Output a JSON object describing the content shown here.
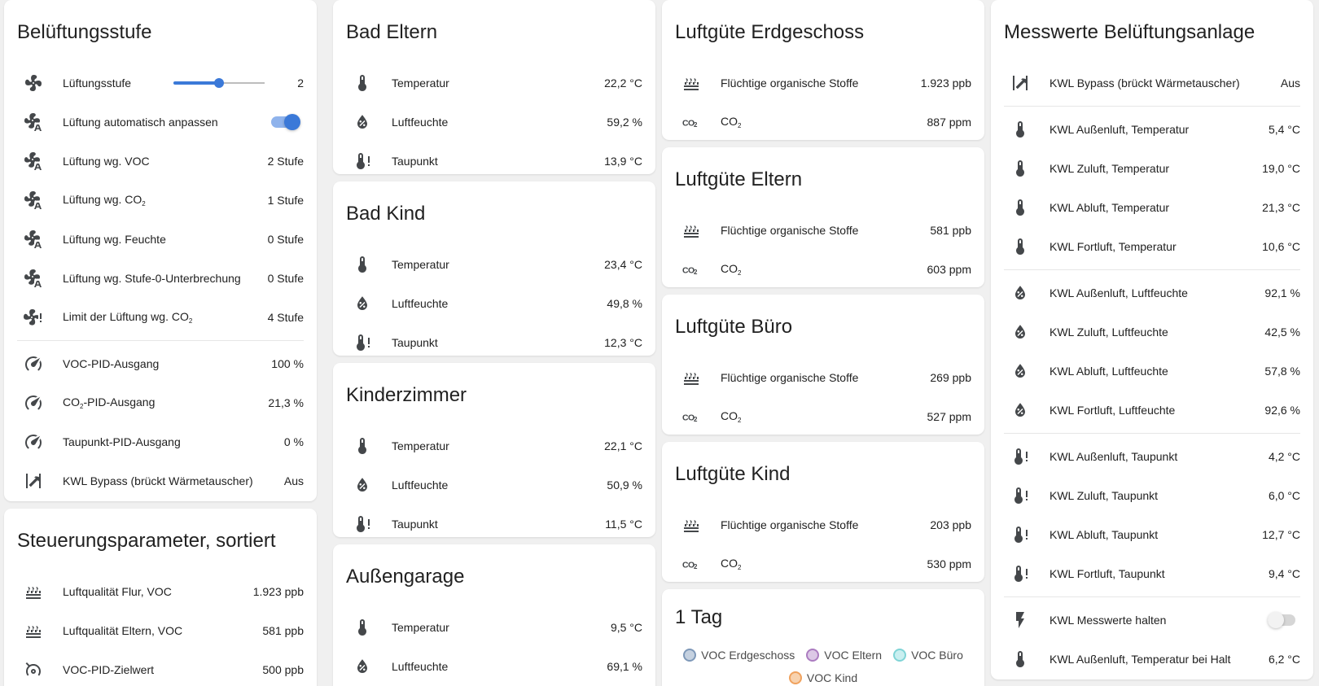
{
  "colors": {
    "accent": "#3b79d8",
    "background": "#f0f0f0",
    "card": "#ffffff",
    "icon": "#44474a"
  },
  "col1": {
    "card1": {
      "title": "Belüftungsstufe",
      "fan_speed": {
        "label": "Lüftungsstufe",
        "value": "2",
        "slider_fraction": 0.5
      },
      "auto_adjust": {
        "label": "Lüftung automatisch anpassen",
        "state": "on"
      },
      "voc": {
        "label": "Lüftung wg. VOC",
        "value": "2 Stufe"
      },
      "co2": {
        "label": "Lüftung wg. CO",
        "sub": "2",
        "value": "1 Stufe"
      },
      "humidity": {
        "label": "Lüftung wg. Feuchte",
        "value": "0 Stufe"
      },
      "stage0": {
        "label": "Lüftung wg. Stufe-0-Unterbrechung",
        "value": "0 Stufe"
      },
      "limit_co2": {
        "label": "Limit der Lüftung wg. CO",
        "sub": "2",
        "value": "4 Stufe"
      },
      "voc_pid": {
        "label": "VOC-PID-Ausgang",
        "value": "100 %"
      },
      "co2_pid": {
        "label_pre": "CO",
        "sub": "2",
        "label_post": "-PID-Ausgang",
        "value": "21,3 %"
      },
      "dew_pid": {
        "label": "Taupunkt-PID-Ausgang",
        "value": "0 %"
      },
      "bypass": {
        "label": "KWL Bypass (brückt Wärmetauscher)",
        "value": "Aus"
      }
    },
    "card2": {
      "title": "Steuerungsparameter, sortiert",
      "rows": [
        {
          "label": "Luftqualität Flur, VOC",
          "value": "1.923 ppb",
          "icon": "voc-icon"
        },
        {
          "label": "Luftqualität Eltern, VOC",
          "value": "581 ppb",
          "icon": "voc-icon"
        },
        {
          "label": "VOC-PID-Zielwert",
          "value": "500 ppb",
          "icon": "target-gauge-icon"
        }
      ]
    }
  },
  "col2": {
    "bad_eltern": {
      "title": "Bad Eltern",
      "temp_label": "Temperatur",
      "temp": "22,2 °C",
      "hum_label": "Luftfeuchte",
      "hum": "59,2 %",
      "dew_label": "Taupunkt",
      "dew": "13,9 °C"
    },
    "bad_kind": {
      "title": "Bad Kind",
      "temp_label": "Temperatur",
      "temp": "23,4 °C",
      "hum_label": "Luftfeuchte",
      "hum": "49,8 %",
      "dew_label": "Taupunkt",
      "dew": "12,3 °C"
    },
    "kinderzimmer": {
      "title": "Kinderzimmer",
      "temp_label": "Temperatur",
      "temp": "22,1 °C",
      "hum_label": "Luftfeuchte",
      "hum": "50,9 %",
      "dew_label": "Taupunkt",
      "dew": "11,5 °C"
    },
    "aussengarage": {
      "title": "Außengarage",
      "temp_label": "Temperatur",
      "temp": "9,5 °C",
      "hum_label": "Luftfeuchte",
      "hum": "69,1 %"
    }
  },
  "col3": {
    "erdgeschoss": {
      "title": "Luftgüte Erdgeschoss",
      "voc_label": "Flüchtige organische Stoffe",
      "voc": "1.923 ppb",
      "co2_label": "CO",
      "co2_sub": "2",
      "co2": "887 ppm"
    },
    "eltern": {
      "title": "Luftgüte Eltern",
      "voc_label": "Flüchtige organische Stoffe",
      "voc": "581 ppb",
      "co2_label": "CO",
      "co2_sub": "2",
      "co2": "603 ppm"
    },
    "buero": {
      "title": "Luftgüte Büro",
      "voc_label": "Flüchtige organische Stoffe",
      "voc": "269 ppb",
      "co2_label": "CO",
      "co2_sub": "2",
      "co2": "527 ppm"
    },
    "kind": {
      "title": "Luftgüte Kind",
      "voc_label": "Flüchtige organische Stoffe",
      "voc": "203 ppb",
      "co2_label": "CO",
      "co2_sub": "2",
      "co2": "530 ppm"
    },
    "history": {
      "title": "1 Tag",
      "legend": [
        {
          "name": "VOC Erdgeschoss",
          "color": "#7e98b8",
          "fill": "#c5d1e0"
        },
        {
          "name": "VOC Eltern",
          "color": "#ab7cc0",
          "fill": "#dcc8e6"
        },
        {
          "name": "VOC Büro",
          "color": "#7fd4d6",
          "fill": "#c9eff0"
        },
        {
          "name": "VOC Kind",
          "color": "#f0a25e",
          "fill": "#f8d2ae"
        }
      ]
    }
  },
  "col4": {
    "title": "Messwerte Belüftungsanlage",
    "bypass": {
      "label": "KWL Bypass (brückt Wärmetauscher)",
      "value": "Aus"
    },
    "temps": [
      {
        "label": "KWL Außenluft, Temperatur",
        "value": "5,4 °C"
      },
      {
        "label": "KWL Zuluft, Temperatur",
        "value": "19,0 °C"
      },
      {
        "label": "KWL Abluft, Temperatur",
        "value": "21,3 °C"
      },
      {
        "label": "KWL Fortluft, Temperatur",
        "value": "10,6 °C"
      }
    ],
    "humidity": [
      {
        "label": "KWL Außenluft, Luftfeuchte",
        "value": "92,1 %"
      },
      {
        "label": "KWL Zuluft, Luftfeuchte",
        "value": "42,5 %"
      },
      {
        "label": "KWL Abluft, Luftfeuchte",
        "value": "57,8 %"
      },
      {
        "label": "KWL Fortluft, Luftfeuchte",
        "value": "92,6 %"
      }
    ],
    "dewpoints": [
      {
        "label": "KWL Außenluft, Taupunkt",
        "value": "4,2 °C"
      },
      {
        "label": "KWL Zuluft, Taupunkt",
        "value": "6,0 °C"
      },
      {
        "label": "KWL Abluft, Taupunkt",
        "value": "12,7 °C"
      },
      {
        "label": "KWL Fortluft, Taupunkt",
        "value": "9,4 °C"
      }
    ],
    "hold": {
      "label": "KWL Messwerte halten",
      "state": "off"
    },
    "hold_temp": {
      "label": "KWL Außenluft, Temperatur bei Halt",
      "value": "6,2 °C"
    }
  }
}
